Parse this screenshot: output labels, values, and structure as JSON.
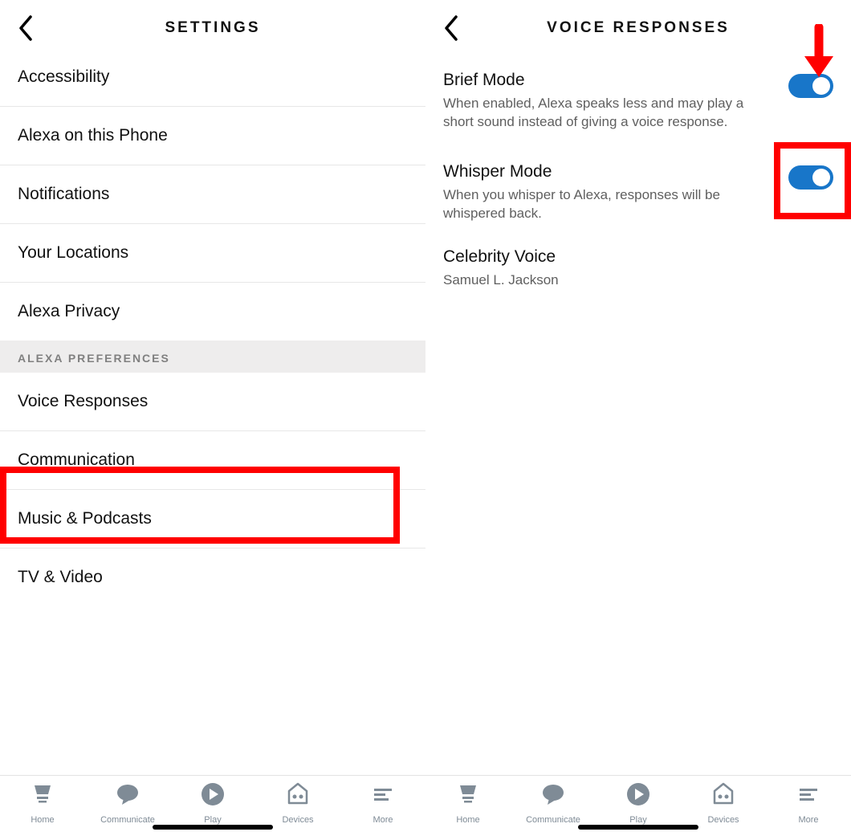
{
  "left": {
    "title": "SETTINGS",
    "items": [
      "Accessibility",
      "Alexa on this Phone",
      "Notifications",
      "Your Locations",
      "Alexa Privacy"
    ],
    "section_header": "ALEXA PREFERENCES",
    "pref_items": [
      "Voice Responses",
      "Communication",
      "Music & Podcasts",
      "TV & Video"
    ]
  },
  "right": {
    "title": "VOICE RESPONSES",
    "brief": {
      "title": "Brief Mode",
      "desc": "When enabled, Alexa speaks less and may play a short sound instead of giving a voice response."
    },
    "whisper": {
      "title": "Whisper Mode",
      "desc": "When you whisper to Alexa, responses will be whispered back."
    },
    "celebrity": {
      "title": "Celebrity Voice",
      "desc": "Samuel L. Jackson"
    }
  },
  "tabs": {
    "home": "Home",
    "communicate": "Communicate",
    "play": "Play",
    "devices": "Devices",
    "more": "More"
  }
}
